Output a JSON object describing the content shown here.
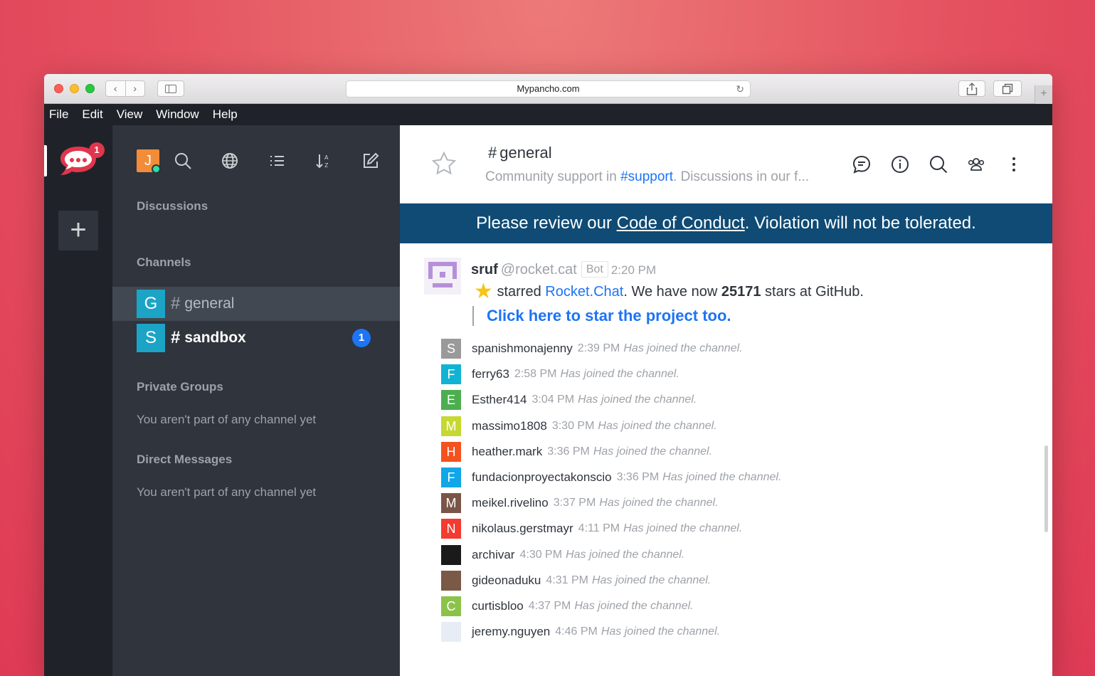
{
  "browser": {
    "url": "Mypancho.com"
  },
  "menu": [
    "File",
    "Edit",
    "View",
    "Window",
    "Help"
  ],
  "servers": {
    "badge": "1",
    "add_label": "+"
  },
  "sidebar": {
    "user_initial": "J",
    "sections": {
      "discussions": "Discussions",
      "channels": "Channels",
      "private_groups": "Private Groups",
      "direct_messages": "Direct Messages"
    },
    "empty_private": "You aren't part of any channel yet",
    "empty_direct": "You aren't part of any channel yet",
    "channels": [
      {
        "initial": "G",
        "name": "general",
        "active": true
      },
      {
        "initial": "S",
        "name": "sandbox",
        "unread": "1"
      }
    ]
  },
  "room": {
    "hash": "#",
    "name": "general",
    "topic_prefix": "Community support in ",
    "topic_link": "#support",
    "topic_suffix": ". Discussions in our f..."
  },
  "announcement": {
    "prefix": "Please review our ",
    "link": "Code of Conduct",
    "suffix": ". Violation will not be tolerated."
  },
  "bot_message": {
    "name": "sruf",
    "username": "@rocket.cat",
    "tag": "Bot",
    "time": "2:20 PM",
    "star": "★",
    "text_prefix": "starred ",
    "text_link": "Rocket.Chat",
    "text_mid": ". We have now ",
    "stars_count": "25171",
    "text_suffix": " stars at GitHub.",
    "attachment": "Click here to star the project too."
  },
  "joins": [
    {
      "initial": "S",
      "color": "#9a9a9a",
      "user": "spanishmonajenny",
      "time": "2:39 PM",
      "msg": "Has joined the channel."
    },
    {
      "initial": "F",
      "color": "#10b3d3",
      "user": "ferry63",
      "time": "2:58 PM",
      "msg": "Has joined the channel."
    },
    {
      "initial": "E",
      "color": "#4cae4f",
      "user": "Esther414",
      "time": "3:04 PM",
      "msg": "Has joined the channel."
    },
    {
      "initial": "M",
      "color": "#c6d831",
      "user": "massimo1808",
      "time": "3:30 PM",
      "msg": "Has joined the channel."
    },
    {
      "initial": "H",
      "color": "#f4511e",
      "user": "heather.mark",
      "time": "3:36 PM",
      "msg": "Has joined the channel."
    },
    {
      "initial": "F",
      "color": "#10a6e8",
      "user": "fundacionproyectakonscio",
      "time": "3:36 PM",
      "msg": "Has joined the channel."
    },
    {
      "initial": "M",
      "color": "#795548",
      "user": "meikel.rivelino",
      "time": "3:37 PM",
      "msg": "Has joined the channel."
    },
    {
      "initial": "N",
      "color": "#f33b2f",
      "user": "nikolaus.gerstmayr",
      "time": "4:11 PM",
      "msg": "Has joined the channel."
    },
    {
      "initial": "",
      "color": "#1a1a1a",
      "user": "archivar",
      "time": "4:30 PM",
      "msg": "Has joined the channel."
    },
    {
      "initial": "",
      "color": "#7a5a46",
      "user": "gideonaduku",
      "time": "4:31 PM",
      "msg": "Has joined the channel."
    },
    {
      "initial": "C",
      "color": "#8bc34a",
      "user": "curtisbloo",
      "time": "4:37 PM",
      "msg": "Has joined the channel."
    },
    {
      "initial": "",
      "color": "#e8edf5",
      "user": "jeremy.nguyen",
      "time": "4:46 PM",
      "msg": "Has joined the channel."
    }
  ]
}
